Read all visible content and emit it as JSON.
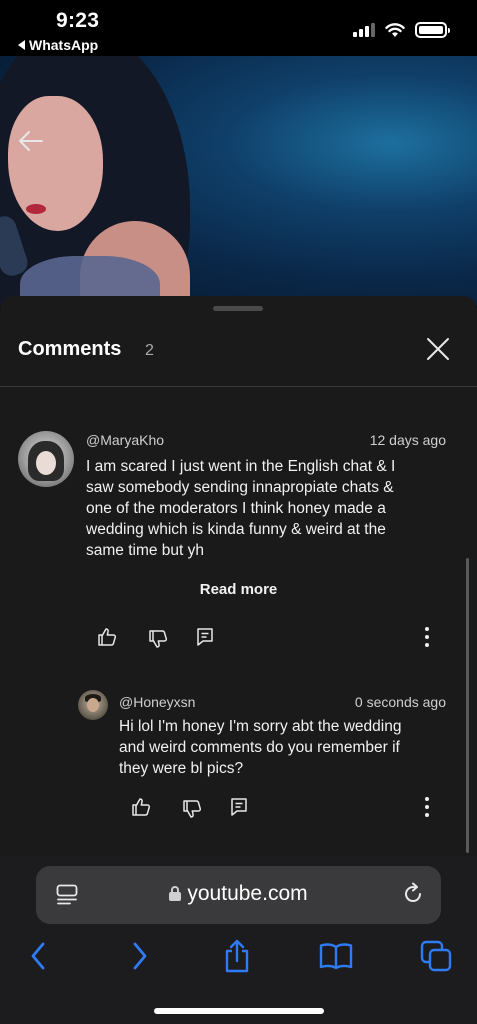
{
  "status_bar": {
    "time": "9:23",
    "back_app": "WhatsApp",
    "icons": [
      "signal-icon",
      "wifi-icon",
      "battery-icon"
    ]
  },
  "video": {
    "back_icon": "arrow-left-icon"
  },
  "comments": {
    "title": "Comments",
    "count": "2",
    "close_icon": "close-icon",
    "items": [
      {
        "author": "@MaryaKho",
        "age": "12 days ago",
        "lines": [
          "I am scared I just went in the English chat & I",
          "saw somebody sending innapropiate chats &",
          "one of the moderators I think honey made a",
          "wedding which is kinda funny & weird at the",
          "same time but yh"
        ],
        "read_more": "Read more",
        "actions": [
          "thumbs-up-icon",
          "thumbs-down-icon",
          "reply-icon",
          "more-vert-icon"
        ]
      },
      {
        "author": "@Honeyxsn",
        "age": "0 seconds ago",
        "lines": [
          "Hi lol I'm honey I'm sorry abt the wedding",
          "and weird comments do you remember if",
          "they were bl pics?"
        ],
        "actions": [
          "thumbs-up-icon",
          "thumbs-down-icon",
          "reply-icon",
          "more-vert-icon"
        ]
      }
    ]
  },
  "browser": {
    "domain": "youtube.com",
    "nav": [
      "back-icon",
      "forward-icon",
      "share-icon",
      "bookmarks-icon",
      "tabs-icon"
    ],
    "accent_color": "#2f7bf5"
  }
}
